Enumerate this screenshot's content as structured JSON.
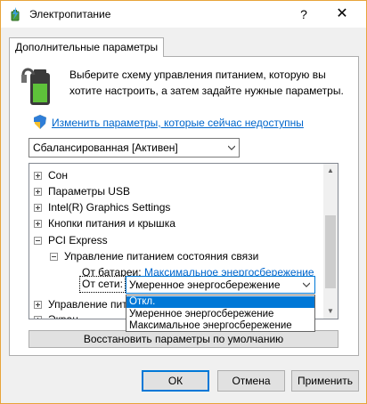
{
  "window": {
    "title": "Электропитание",
    "help_glyph": "?",
    "close_glyph": "✕",
    "icon": "power-options-icon"
  },
  "tab": {
    "label": "Дополнительные параметры"
  },
  "intro": {
    "icon": "battery-power-icon",
    "text": "Выберите схему управления питанием, которую вы хотите настроить, а затем задайте нужные параметры."
  },
  "change_link": {
    "icon": "uac-shield-icon",
    "text": "Изменить параметры, которые сейчас недоступны"
  },
  "scheme_select": {
    "value": "Сбалансированная [Активен]"
  },
  "tree": {
    "items": [
      {
        "label": "Сон",
        "state": "collapsed"
      },
      {
        "label": "Параметры USB",
        "state": "collapsed"
      },
      {
        "label": "Intel(R) Graphics Settings",
        "state": "collapsed"
      },
      {
        "label": "Кнопки питания и крышка",
        "state": "collapsed"
      },
      {
        "label": "PCI Express",
        "state": "expanded"
      },
      {
        "label": "Управление питанием состояния связи",
        "state": "expanded"
      },
      {
        "label": "От батареи:",
        "value": "Максимальное энергосбережение"
      },
      {
        "label": "От сети:",
        "value": "Умеренное энергосбережение"
      },
      {
        "label": "Управление пита",
        "state": "collapsed"
      },
      {
        "label": "Экран",
        "state": "collapsed"
      }
    ]
  },
  "dropdown": {
    "options": [
      "Откл.",
      "Умеренное энергосбережение",
      "Максимальное энергосбережение"
    ],
    "highlighted": "Откл."
  },
  "buttons": {
    "restore": "Восстановить параметры по умолчанию",
    "ok": "ОК",
    "cancel": "Отмена",
    "apply": "Применить"
  },
  "colors": {
    "accent": "#0078d7",
    "link": "#0066cc",
    "border_accent": "#e8a43a"
  }
}
